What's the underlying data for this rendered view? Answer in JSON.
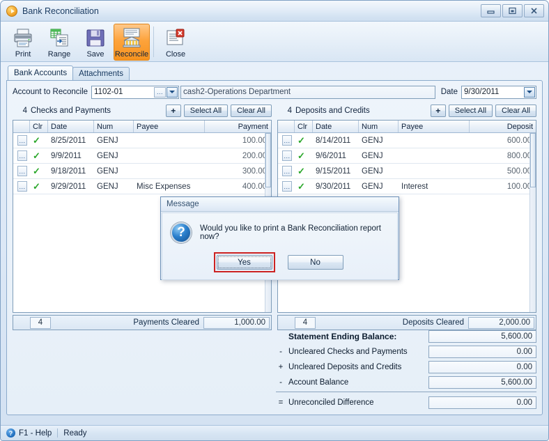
{
  "window": {
    "title": "Bank Reconciliation",
    "app_icon": "play-circle-icon",
    "controls": [
      {
        "name": "minimize-button",
        "glyph": "minimize-icon"
      },
      {
        "name": "restore-button",
        "glyph": "restore-icon"
      },
      {
        "name": "close-button",
        "glyph": "close-x-icon"
      }
    ]
  },
  "toolbar": {
    "buttons": [
      {
        "label": "Print",
        "icon": "printer-icon",
        "active": false
      },
      {
        "label": "Range",
        "icon": "range-list-icon",
        "active": false
      },
      {
        "label": "Save",
        "icon": "floppy-disk-icon",
        "active": false
      },
      {
        "label": "Reconcile",
        "icon": "bank-building-icon",
        "active": true
      },
      {
        "label": "Close",
        "icon": "document-close-icon",
        "active": false
      }
    ]
  },
  "tabs": [
    {
      "label": "Bank Accounts",
      "selected": true
    },
    {
      "label": "Attachments",
      "selected": false
    }
  ],
  "account_row": {
    "label": "Account to Reconcile",
    "code_value": "1102-01",
    "ellipsis_label": "...",
    "name_value": "cash2-Operations Department",
    "date_label": "Date",
    "date_value": "9/30/2011"
  },
  "left_panel": {
    "count": "4",
    "title": "Checks and Payments",
    "add_label": "+",
    "select_all_label": "Select All",
    "clear_all_label": "Clear All",
    "columns": [
      "",
      "Clr",
      "Date",
      "Num",
      "Payee",
      "Payment"
    ],
    "rows": [
      {
        "row_button": "...",
        "cleared": "✓",
        "date": "8/25/2011",
        "num": "GENJ",
        "payee": "",
        "amount": "100.00"
      },
      {
        "row_button": "...",
        "cleared": "✓",
        "date": "9/9/2011",
        "num": "GENJ",
        "payee": "",
        "amount": "200.00"
      },
      {
        "row_button": "...",
        "cleared": "✓",
        "date": "9/18/2011",
        "num": "GENJ",
        "payee": "",
        "amount": "300.00"
      },
      {
        "row_button": "...",
        "cleared": "✓",
        "date": "9/29/2011",
        "num": "GENJ",
        "payee": "Misc Expenses",
        "amount": "400.00"
      }
    ],
    "total_count": "4",
    "total_label": "Payments Cleared",
    "total_value": "1,000.00"
  },
  "right_panel": {
    "count": "4",
    "title": "Deposits and Credits",
    "add_label": "+",
    "select_all_label": "Select All",
    "clear_all_label": "Clear All",
    "columns": [
      "",
      "Clr",
      "Date",
      "Num",
      "Payee",
      "Deposit"
    ],
    "rows": [
      {
        "row_button": "...",
        "cleared": "✓",
        "date": "8/14/2011",
        "num": "GENJ",
        "payee": "",
        "amount": "600.00"
      },
      {
        "row_button": "...",
        "cleared": "✓",
        "date": "9/6/2011",
        "num": "GENJ",
        "payee": "",
        "amount": "800.00"
      },
      {
        "row_button": "...",
        "cleared": "✓",
        "date": "9/15/2011",
        "num": "GENJ",
        "payee": "",
        "amount": "500.00"
      },
      {
        "row_button": "...",
        "cleared": "✓",
        "date": "9/30/2011",
        "num": "GENJ",
        "payee": "Interest",
        "amount": "100.00"
      }
    ],
    "total_count": "4",
    "total_label": "Deposits Cleared",
    "total_value": "2,000.00"
  },
  "summary": {
    "rows": [
      {
        "op": "",
        "label": "Statement Ending Balance:",
        "value": "5,600.00",
        "bold": true
      },
      {
        "op": "-",
        "label": "Uncleared Checks and Payments",
        "value": "0.00",
        "bold": false
      },
      {
        "op": "+",
        "label": "Uncleared Deposits and Credits",
        "value": "0.00",
        "bold": false
      },
      {
        "op": "-",
        "label": "Account Balance",
        "value": "5,600.00",
        "bold": false
      }
    ],
    "final": {
      "op": "=",
      "label": "Unreconciled Difference",
      "value": "0.00"
    }
  },
  "statusbar": {
    "help_icon": "question-circle-icon",
    "help_text": "F1 - Help",
    "status_text": "Ready"
  },
  "dialog": {
    "title": "Message",
    "icon": "question-circle-icon",
    "message": "Would you like to print a Bank Reconciliation report now?",
    "yes_label": "Yes",
    "no_label": "No",
    "highlight_color": "#cc2222"
  }
}
